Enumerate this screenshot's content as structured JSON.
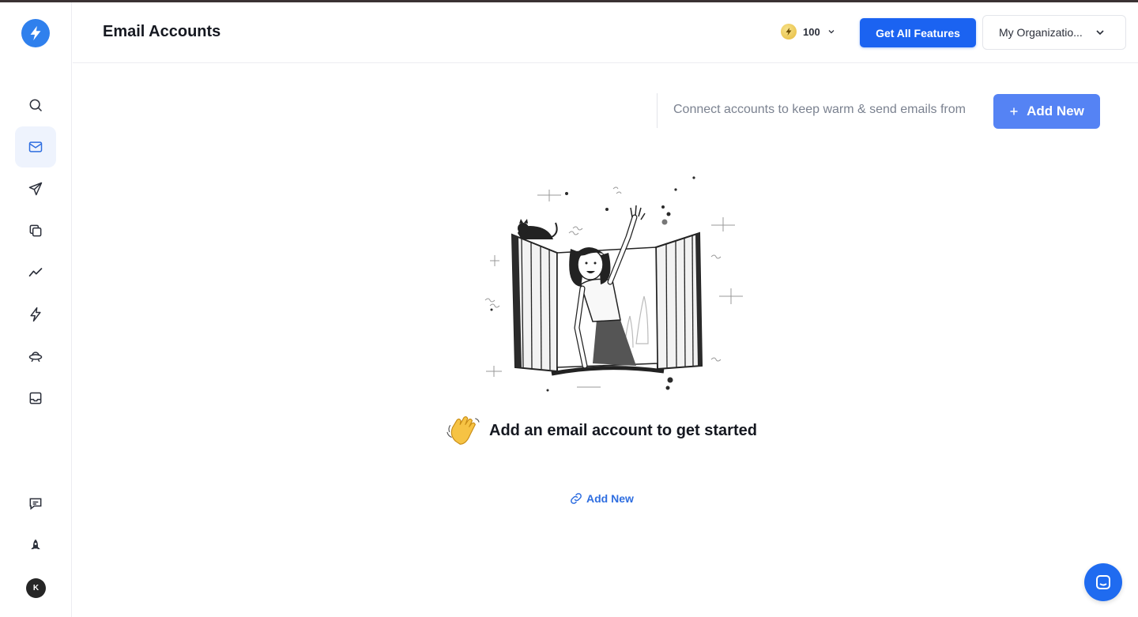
{
  "header": {
    "title": "Email Accounts",
    "credits": "100",
    "get_features_label": "Get All Features",
    "org_label": "My Organizatio..."
  },
  "toolbar": {
    "description": "Connect accounts to keep warm & send emails from",
    "add_new_label": "Add New"
  },
  "empty_state": {
    "message": "Add an email account to get started",
    "link_label": "Add New"
  },
  "sidebar": {
    "items": [
      {
        "icon": "search-icon"
      },
      {
        "icon": "mail-icon",
        "active": true
      },
      {
        "icon": "send-icon"
      },
      {
        "icon": "copy-icon"
      },
      {
        "icon": "analytics-icon"
      },
      {
        "icon": "bolt-icon"
      },
      {
        "icon": "ufo-icon"
      },
      {
        "icon": "inbox-icon"
      }
    ],
    "bottom_items": [
      {
        "icon": "feedback-icon"
      },
      {
        "icon": "rocket-icon"
      }
    ],
    "avatar_initial": "K"
  },
  "colors": {
    "primary": "#1b63f1",
    "add_button": "#5583f4",
    "link": "#2f6ee0",
    "logo": "#2f80ed",
    "active_nav_bg": "#eef3fd"
  }
}
